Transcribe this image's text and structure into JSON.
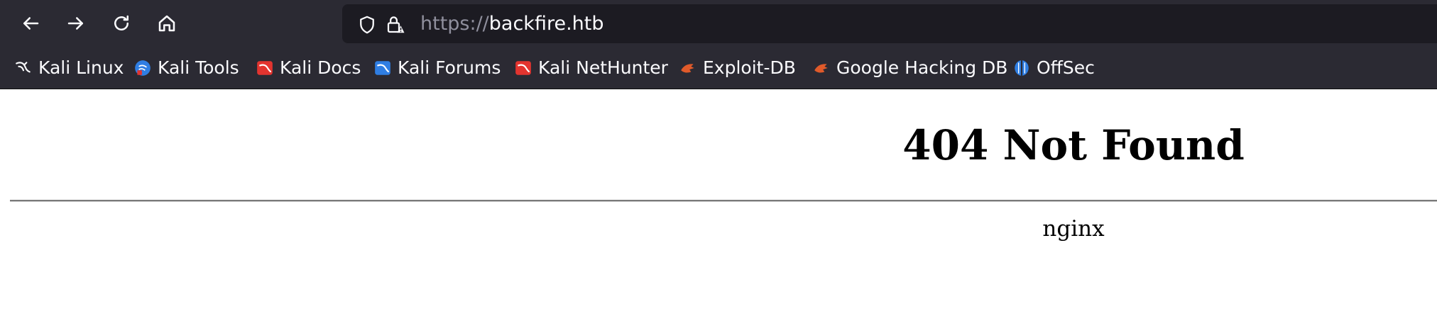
{
  "toolbar": {
    "back_icon": "arrow-left-icon",
    "forward_icon": "arrow-right-icon",
    "reload_icon": "reload-icon",
    "home_icon": "home-icon"
  },
  "urlbar": {
    "scheme": "https://",
    "host": "backfire.htb",
    "tracking_icon": "shield-icon",
    "security_icon": "lock-warning-icon"
  },
  "bookmarks": [
    {
      "label": "Kali Linux",
      "icon": "kali-dragon-icon"
    },
    {
      "label": "Kali Tools",
      "icon": "kali-tools-icon"
    },
    {
      "label": "Kali Docs",
      "icon": "kali-docs-icon"
    },
    {
      "label": "Kali Forums",
      "icon": "kali-forums-icon"
    },
    {
      "label": "Kali NetHunter",
      "icon": "kali-nethunter-icon"
    },
    {
      "label": "Exploit-DB",
      "icon": "exploit-db-icon"
    },
    {
      "label": "Google Hacking DB",
      "icon": "ghdb-icon"
    },
    {
      "label": "OffSec",
      "icon": "offsec-icon"
    }
  ],
  "page": {
    "heading": "404 Not Found",
    "server": "nginx"
  },
  "colors": {
    "toolbar_bg": "#2b2a33",
    "urlbar_bg": "#1c1b22",
    "text_light": "#fbfbfe",
    "scheme_gray": "#8f8f9d",
    "bookmark_red": "#e3342f",
    "bookmark_blue": "#2f7ee3",
    "exploit_orange": "#e05a2a"
  }
}
